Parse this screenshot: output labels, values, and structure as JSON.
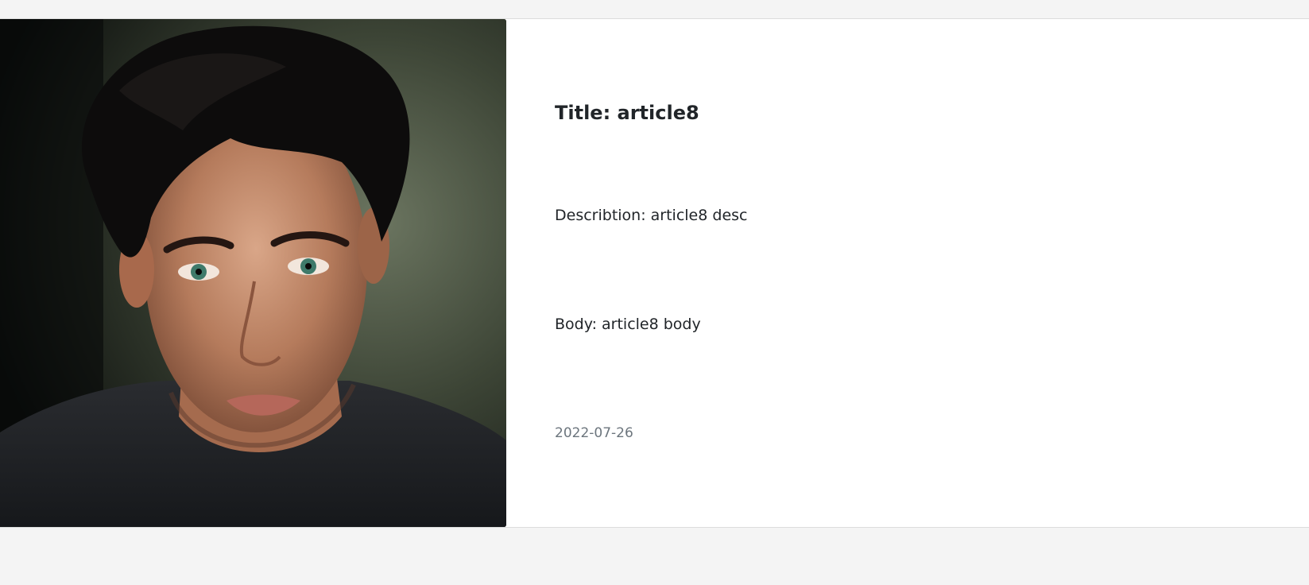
{
  "article": {
    "title": "Title: article8",
    "description": "Describtion: article8 desc",
    "body": "Body: article8 body",
    "date": "2022-07-26",
    "image": "portrait-photo"
  },
  "colors": {
    "page_background": "#f4f4f4",
    "card_background": "#ffffff",
    "title_text": "#212529",
    "muted_text": "#6c757d"
  }
}
